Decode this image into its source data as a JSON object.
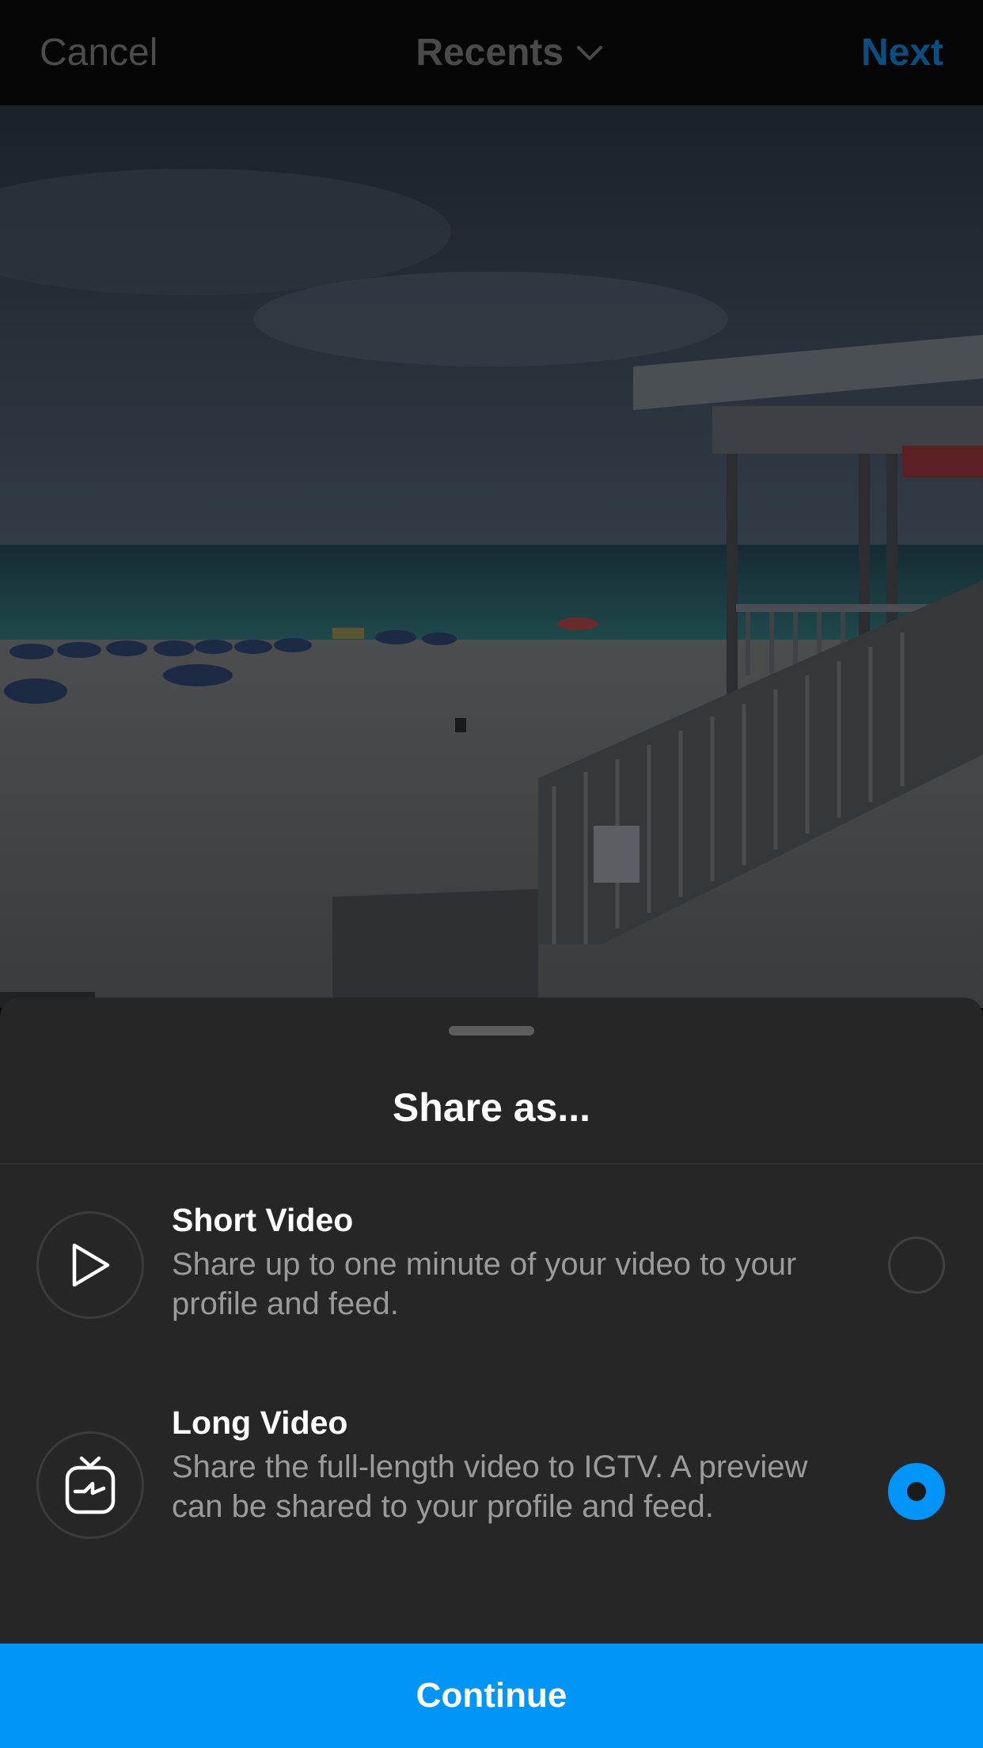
{
  "topbar": {
    "cancel_label": "Cancel",
    "title": "Recents",
    "title_icon": "chevron-down-icon",
    "next_label": "Next"
  },
  "sheet": {
    "title": "Share as...",
    "options": [
      {
        "icon": "play-icon",
        "title": "Short Video",
        "description": "Share up to one minute of your video to your profile and feed.",
        "selected": false
      },
      {
        "icon": "igtv-icon",
        "title": "Long Video",
        "description": "Share the full-length video to IGTV. A preview can be shared to your profile and feed.",
        "selected": true
      }
    ],
    "continue_label": "Continue"
  },
  "colors": {
    "accent": "#0095f6",
    "sheet_background": "#262626",
    "secondary_text": "#9b9b9b"
  }
}
